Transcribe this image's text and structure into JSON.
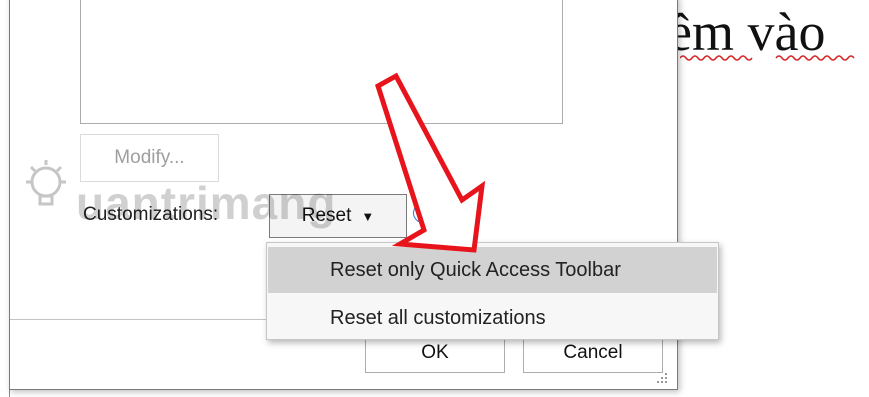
{
  "document": {
    "visible_text": "ềm vào"
  },
  "dialog": {
    "modify_label": "Modify...",
    "customizations_label": "Customizations:",
    "reset_label": "Reset",
    "info_glyph": "i",
    "ok_label": "OK",
    "cancel_label": "Cancel"
  },
  "reset_menu": {
    "items": [
      {
        "label": "Reset only Quick Access Toolbar",
        "highlighted": true
      },
      {
        "label": "Reset all customizations",
        "highlighted": false
      }
    ]
  },
  "watermark": {
    "text": "uantrimang"
  },
  "annotation": {
    "arrow_color": "#e8141c"
  },
  "colors": {
    "accent": "#2b7bd0",
    "menu_highlight": "#d2d2d2",
    "squiggle": "#d42a2a"
  }
}
